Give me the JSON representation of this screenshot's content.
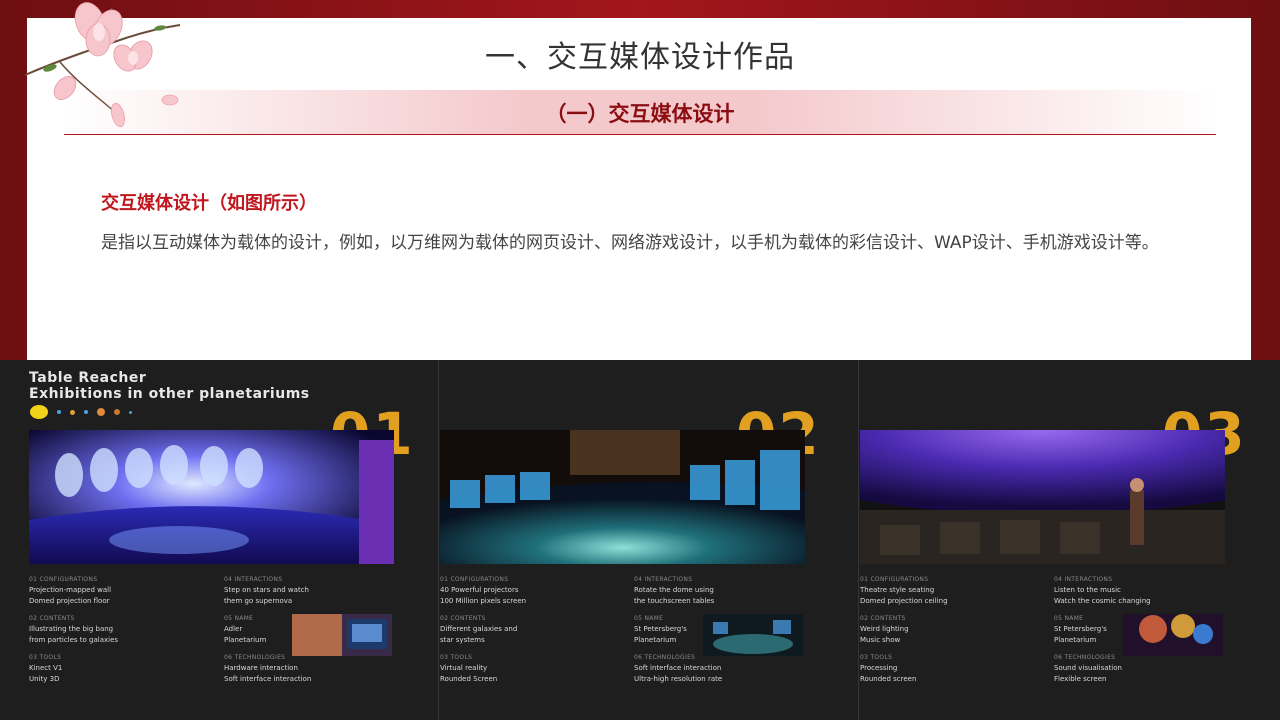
{
  "slide": {
    "title": "一、交互媒体设计作品",
    "subtitle": "（一）交互媒体设计",
    "heading": "交互媒体设计（如图所示）",
    "body": "是指以互动媒体为载体的设计，例如，以万维网为载体的网页设计、网络游戏设计，以手机为载体的彩信设计、WAP设计、手机游戏设计等。"
  },
  "poster": {
    "title_line1": "Table Reacher",
    "title_line2": "Exhibitions in other planetariums",
    "dots": [
      "#f3d21a",
      "#4aa3e0",
      "#e0a33a",
      "#4aa3e0",
      "#e08a3a",
      "#c77b2a",
      "#4aa3e0"
    ],
    "panels": [
      {
        "number": "01",
        "left": {
          "config_label": "01 CONFIGURATIONS",
          "config_lines": [
            "Projection-mapped wall",
            "Domed projection floor"
          ],
          "content_label": "02 CONTENTS",
          "content_lines": [
            "Illustrating the big bang",
            "from particles to galaxies"
          ],
          "tools_label": "03 TOOLS",
          "tools_lines": [
            "Kinect V1",
            "Unity 3D"
          ]
        },
        "right": {
          "inter_label": "04 INTERACTIONS",
          "inter_lines": [
            "Step on stars and watch",
            "them go supernova"
          ],
          "name_label": "05 NAME",
          "name_lines": [
            "Adler",
            "Planetarium"
          ],
          "tech_label": "06 TECHNOLOGIES",
          "tech_lines": [
            "Hardware interaction",
            "Soft interface interaction"
          ]
        }
      },
      {
        "number": "02",
        "left": {
          "config_label": "01 CONFIGURATIONS",
          "config_lines": [
            "40 Powerful projectors",
            "100 Million pixels screen"
          ],
          "content_label": "02 CONTENTS",
          "content_lines": [
            "Different galaxies and",
            "star systems"
          ],
          "tools_label": "03 TOOLS",
          "tools_lines": [
            "Virtual reality",
            "Rounded Screen"
          ]
        },
        "right": {
          "inter_label": "04 INTERACTIONS",
          "inter_lines": [
            "Rotate the dome using",
            "the touchscreen tables"
          ],
          "name_label": "05 NAME",
          "name_lines": [
            "St Petersberg's",
            "Planetarium"
          ],
          "tech_label": "06 TECHNOLOGIES",
          "tech_lines": [
            "Soft interface interaction",
            "Ultra-high resolution rate"
          ]
        }
      },
      {
        "number": "03",
        "left": {
          "config_label": "01 CONFIGURATIONS",
          "config_lines": [
            "Theatre style seating",
            "Domed projection ceiling"
          ],
          "content_label": "02 CONTENTS",
          "content_lines": [
            "Weird lighting",
            "Music show"
          ],
          "tools_label": "03 TOOLS",
          "tools_lines": [
            "Processing",
            "Rounded screen"
          ]
        },
        "right": {
          "inter_label": "04 INTERACTIONS",
          "inter_lines": [
            "Listen to the music",
            "Watch the cosmic changing"
          ],
          "name_label": "05 NAME",
          "name_lines": [
            "St Petersberg's",
            "Planetarium"
          ],
          "tech_label": "06 TECHNOLOGIES",
          "tech_lines": [
            "Sound visualisation",
            "Flexible screen"
          ]
        }
      }
    ]
  }
}
